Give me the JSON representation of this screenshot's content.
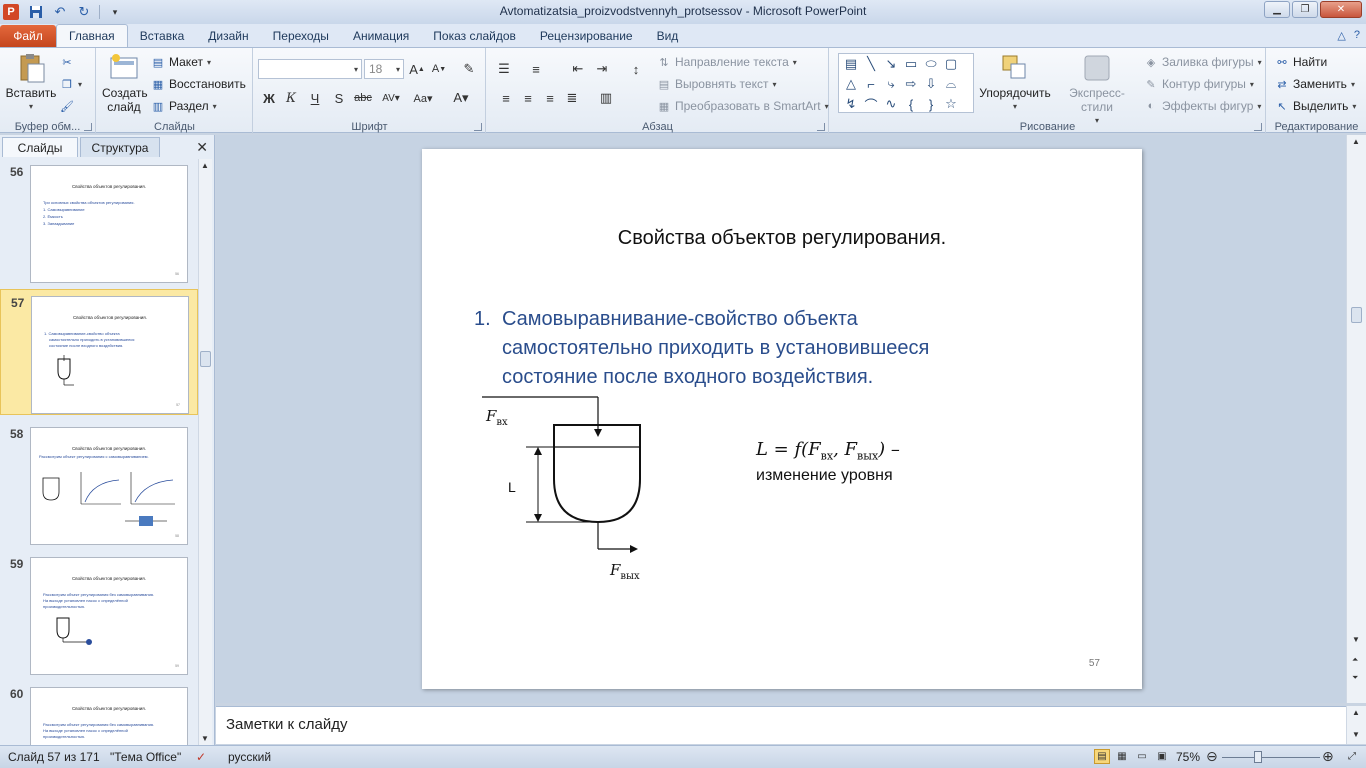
{
  "window": {
    "title": "Avtomatizatsia_proizvodstvennyh_protsessov  -  Microsoft PowerPoint",
    "app_icon": "P"
  },
  "tabs": [
    "Файл",
    "Главная",
    "Вставка",
    "Дизайн",
    "Переходы",
    "Анимация",
    "Показ слайдов",
    "Рецензирование",
    "Вид"
  ],
  "ribbon": {
    "clipboard": {
      "label": "Буфер обм...",
      "paste": "Вставить"
    },
    "slides": {
      "label": "Слайды",
      "new_slide": "Создать слайд",
      "layout": "Макет",
      "reset": "Восстановить",
      "section": "Раздел"
    },
    "font": {
      "label": "Шрифт",
      "font_name": "",
      "font_size": "18"
    },
    "paragraph": {
      "label": "Абзац",
      "text_direction": "Направление текста",
      "align_text": "Выровнять текст",
      "smartart": "Преобразовать в SmartArt"
    },
    "drawing": {
      "label": "Рисование",
      "arrange": "Упорядочить",
      "quick_styles": "Экспресс-стили",
      "shape_fill": "Заливка фигуры",
      "shape_outline": "Контур фигуры",
      "shape_effects": "Эффекты фигур"
    },
    "editing": {
      "label": "Редактирование",
      "find": "Найти",
      "replace": "Заменить",
      "select": "Выделить"
    }
  },
  "left_panel": {
    "tab_slides": "Слайды",
    "tab_outline": "Структура",
    "thumbnails": [
      {
        "number": "56",
        "title": "Свойства объектов регулирования.",
        "lines": [
          "Три основных свойства объектов регулирования.",
          "1.  Самовыравнивание",
          "2.  Ёмкость",
          "3.  Запаздывание"
        ],
        "page": "56"
      },
      {
        "number": "57",
        "title": "Свойства объектов регулирования.",
        "lines": [
          "1.  Самовыравнивание-свойство объекта",
          "самостоятельно приходить в установившееся",
          "состояние после входного воздействия."
        ],
        "page": "57"
      },
      {
        "number": "58",
        "title": "Свойства объектов регулирования.",
        "lines": [
          "Рассмотрим объект регулирования с самовыравниванием."
        ],
        "page": "58"
      },
      {
        "number": "59",
        "title": "Свойства объектов регулирования.",
        "lines": [
          "Рассмотрим объект регулирования без самовыравнивания.",
          "На выходе установлен насос с определённой",
          "производительностью."
        ],
        "page": "59"
      },
      {
        "number": "60",
        "title": "Свойства объектов регулирования.",
        "lines": [
          "Рассмотрим объект регулирования без самовыравнивания.",
          "На выходе установлен насос с определённой",
          "производительностью."
        ],
        "page": "60"
      }
    ]
  },
  "slide": {
    "title": "Свойства объектов регулирования.",
    "list_number": "1.",
    "list_text": "Самовыравнивание-свойство объекта самостоятельно приходить в установившееся состояние после входного воздействия.",
    "formula_text": "L = f(F",
    "formula_sub1": "вх",
    "formula_mid": ", F",
    "formula_sub2": "вых",
    "formula_end": ") –",
    "formula_desc": "изменение уровня",
    "label_fin": "F",
    "label_fin_sub": "вх",
    "label_fout": "F",
    "label_fout_sub": "вых",
    "label_L": "L",
    "page_number": "57"
  },
  "notes": {
    "placeholder": "Заметки к слайду"
  },
  "status": {
    "slide_info": "Слайд 57 из 171",
    "theme": "\"Тема Office\"",
    "language": "русский",
    "zoom": "75%"
  },
  "colors": {
    "accent_blue": "#2a4d8c",
    "file_tab": "#d24726",
    "selected_thumb": "#fbe9a4"
  }
}
